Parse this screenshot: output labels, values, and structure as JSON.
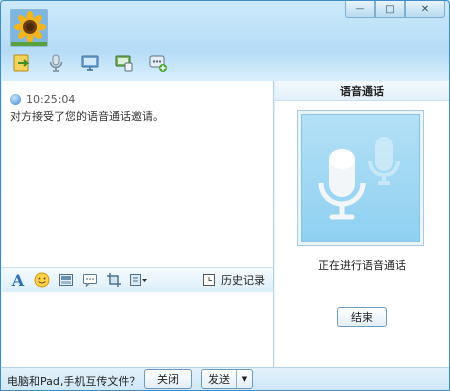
{
  "window": {
    "buttons": {
      "minimize": "—",
      "maximize": "□",
      "close": "✕"
    }
  },
  "toolbar": {
    "items": [
      {
        "icon": "transfer-file-icon"
      },
      {
        "icon": "microphone-icon"
      },
      {
        "icon": "video-monitor-icon"
      },
      {
        "icon": "remote-desktop-icon"
      },
      {
        "icon": "more-apps-icon"
      }
    ]
  },
  "chat": {
    "time": "10:25:04",
    "message": "对方接受了您的语音通话邀请。"
  },
  "format_bar": {
    "font_glyph": "A",
    "history_label": "历史记录"
  },
  "bottom": {
    "tip": "电脑和Pad,手机互传文件？",
    "close_label": "关闭",
    "send_label": "发送",
    "send_dropdown": "▼"
  },
  "voice_panel": {
    "title": "语音通话",
    "status": "正在进行语音通话",
    "end_label": "结束"
  },
  "colors": {
    "border": "#3e8cc5",
    "panel_blue": "#8fd0f1",
    "title_bg": "#b5dcf6"
  }
}
